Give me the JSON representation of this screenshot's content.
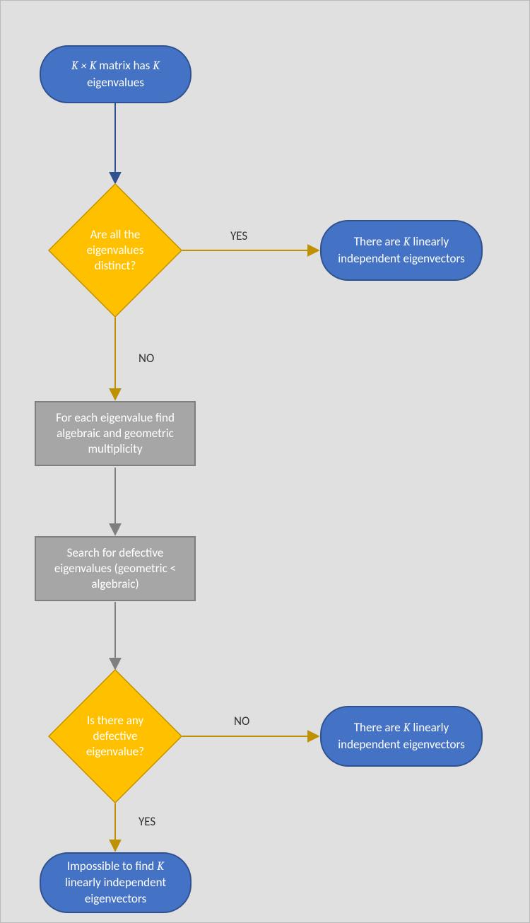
{
  "nodes": {
    "start": {
      "pre": "K × K",
      "mid": " matrix has ",
      "post": "K",
      "tail": " eigenvalues"
    },
    "decision1": "Are all the eigenvalues distinct?",
    "result_yes1_pre": "There are ",
    "result_yes1_k": "K",
    "result_yes1_post": " linearly independent eigenvectors",
    "process1": "For each eigenvalue find algebraic and geometric multiplicity",
    "process2": "Search for defective eigenvalues (geometric < algebraic)",
    "decision2": "Is there any defective eigenvalue?",
    "result_no2_pre": "There are ",
    "result_no2_k": "K",
    "result_no2_post": " linearly independent eigenvectors",
    "result_yes2_pre": "Impossible to find ",
    "result_yes2_k": "K",
    "result_yes2_post": " linearly independent eigenvectors"
  },
  "labels": {
    "yes1": "YES",
    "no1": "NO",
    "no2": "NO",
    "yes2": "YES"
  },
  "colors": {
    "terminator_fill": "#4472c4",
    "terminator_stroke": "#2f528f",
    "decision_fill": "#ffc000",
    "decision_stroke": "#bf9000",
    "process_fill": "#a6a6a6",
    "process_stroke": "#7f7f7f"
  }
}
